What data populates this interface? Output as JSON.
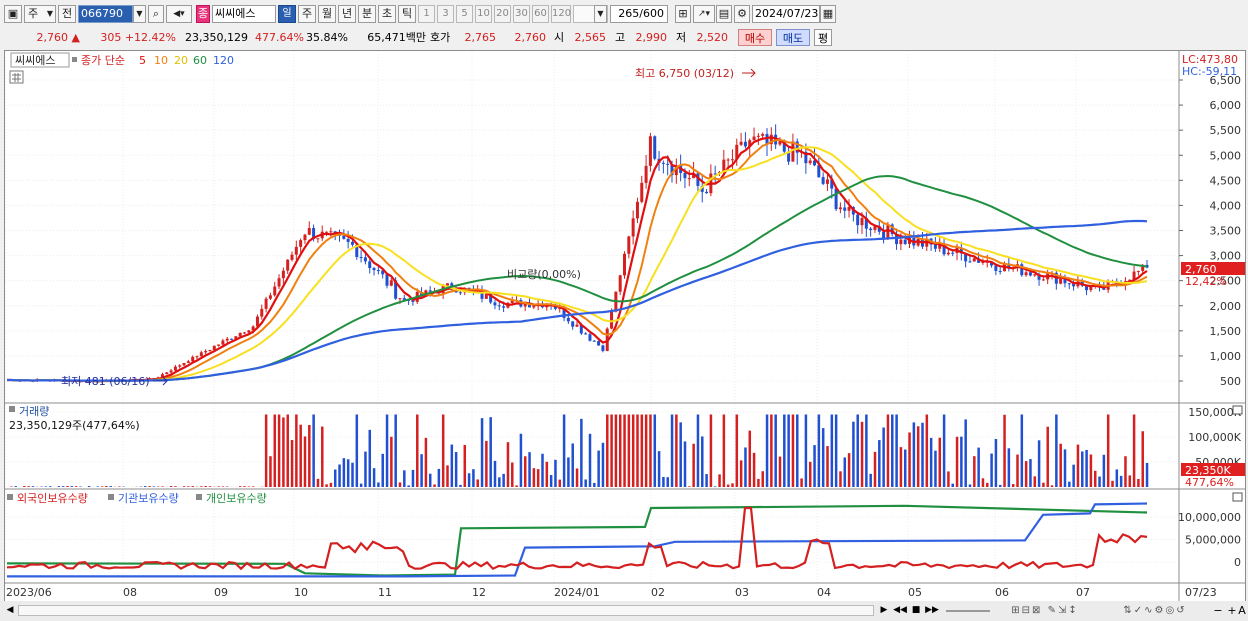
{
  "toolbar": {
    "period_label": "주",
    "prev_label": "전",
    "code": "066790",
    "tag": "종",
    "stock_name": "씨씨에스",
    "periods": [
      "일",
      "주",
      "월",
      "년",
      "분",
      "초",
      "틱"
    ],
    "selected_period": "일",
    "intervals": [
      "1",
      "3",
      "5",
      "10",
      "20",
      "30",
      "60",
      "120"
    ],
    "count_value": "265",
    "count_total": "/600",
    "date": "2024/07/23"
  },
  "quote": {
    "price": "2,760",
    "change": "305 +12.42%",
    "volume": "23,350,129",
    "vol_ratio": "477.64%",
    "turnover": "35.84%",
    "amount": "65,471백만",
    "hoga_label": "호가",
    "ask": "2,765",
    "bid": "2,760",
    "open_label": "시",
    "open": "2,565",
    "high_label": "고",
    "high": "2,990",
    "low_label": "저",
    "low": "2,520",
    "buy_label": "매수",
    "sell_label": "매도",
    "eval_label": "평"
  },
  "main_chart": {
    "legend_name": "씨씨에스",
    "legend_close": "종가 단순",
    "legend_ma": [
      "5",
      "10",
      "20",
      "60",
      "120"
    ],
    "lc_label": "LC:473,80",
    "hc_label": "HC:-59,11",
    "high_note": "최고 6,750 (03/12)",
    "low_note": "최저 481 (06/16)",
    "mid_note": "비교량(0,00%)",
    "price_tag": "2,760",
    "pct_tag": "12,42%",
    "y_ticks": [
      "6,500",
      "6,000",
      "5,500",
      "5,000",
      "4,500",
      "4,000",
      "3,500",
      "3,000",
      "2,500",
      "2,000",
      "1,500",
      "1,000",
      "500"
    ]
  },
  "volume_chart": {
    "title": "거래량",
    "info": "23,350,129주(477,64%)",
    "y_ticks": [
      "150,000K",
      "100,000K",
      "50,000K"
    ],
    "tag": "23,350K",
    "tag_pct": "477,64%"
  },
  "holding_chart": {
    "legend": [
      "외국인보유수량",
      "기관보유수량",
      "개인보유수량"
    ],
    "y_ticks": [
      "10,000,000",
      "5,000,000",
      "0"
    ]
  },
  "x_axis": [
    "2023/06",
    "08",
    "09",
    "10",
    "11",
    "12",
    "2024/01",
    "02",
    "03",
    "04",
    "05",
    "06",
    "07",
    "07/23"
  ],
  "colors": {
    "up": "#d42020",
    "down": "#2050d0",
    "ma5": "#e01010",
    "ma10": "#f08010",
    "ma20": "#f8e020",
    "ma60": "#209040",
    "ma120": "#3060e0"
  },
  "chart_data": {
    "type": "line",
    "x": [
      "2023/06",
      "2023/07",
      "2023/08",
      "2023/09",
      "2023/10",
      "2023/10",
      "2023/11",
      "2023/11",
      "2023/12",
      "2023/12",
      "2024/01",
      "2024/01",
      "2024/02",
      "2024/02",
      "2024/03",
      "2024/03",
      "2024/04",
      "2024/04",
      "2024/05",
      "2024/05",
      "2024/06",
      "2024/06",
      "2024/07",
      "2024/07/23"
    ],
    "series": [
      {
        "name": "종가",
        "values": [
          520,
          510,
          500,
          540,
          1100,
          1600,
          3500,
          3200,
          2100,
          2400,
          2050,
          2050,
          1150,
          5200,
          4300,
          5300,
          5000,
          3800,
          3350,
          3100,
          2800,
          2600,
          2300,
          2760
        ]
      }
    ],
    "ylim": [
      0,
      6800
    ]
  }
}
